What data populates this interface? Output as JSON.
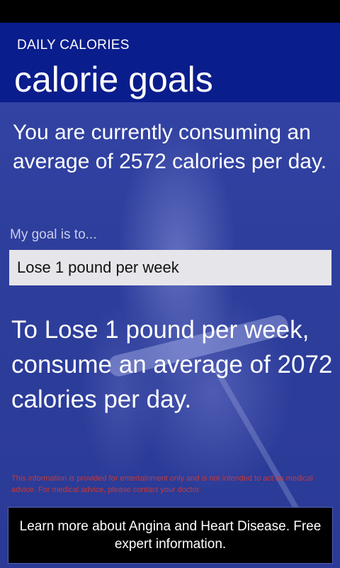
{
  "header": {
    "app_title": "DAILY CALORIES",
    "page_title": "calorie goals"
  },
  "main": {
    "current_text": "You are currently consuming an average of 2572 calories per day.",
    "goal_label": "My goal is to...",
    "goal_selected": "Lose 1 pound per week",
    "result_text": "To Lose 1 pound per week, consume an average of 2072 calories per day.",
    "disclaimer": "This information is provided for entertainment only and is not intended to act as medical advice. For medical advice, please contact your doctor."
  },
  "ad": {
    "text": "Learn more about Angina and Heart Disease. Free expert information."
  },
  "colors": {
    "header_bg": "#0a1d8c",
    "page_bg": "#2f3f9f",
    "select_bg": "#e6e6ea",
    "disclaimer": "#c43a3a"
  }
}
